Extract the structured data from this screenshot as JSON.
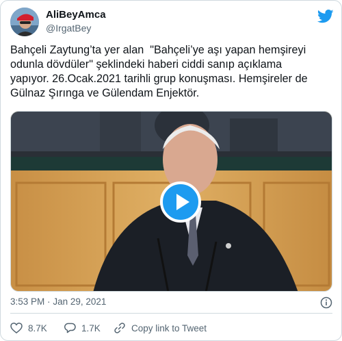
{
  "colors": {
    "accent": "#1d9bf0",
    "text": "#0f1419",
    "secondary": "#536471",
    "border": "#cfd9de"
  },
  "author": {
    "display_name": "AliBeyAmca",
    "handle": "@IrgatBey"
  },
  "tweet": {
    "text": "Bahçeli Zaytung’ta yer alan  \"Bahçeli’ye aşı yapan hemşireyi\nodunla dövdüler\" şeklindeki haberi ciddi sanıp açıklama\nyapıyor. 26.Ocak.2021 tarihli grup konuşması. Hemşireler de\nGülnaz Şırınga ve Gülendam Enjektör."
  },
  "media": {
    "type": "video",
    "icon": "play-icon"
  },
  "meta": {
    "time": "3:53 PM",
    "separator": "·",
    "date": "Jan 29, 2021",
    "info_icon": "info-icon"
  },
  "actions": {
    "likes": {
      "icon": "heart-icon",
      "count": "8.7K"
    },
    "replies": {
      "icon": "reply-icon",
      "count": "1.7K"
    },
    "copy": {
      "icon": "link-icon",
      "label": "Copy link to Tweet"
    }
  },
  "brand_icon": "twitter-bird-icon"
}
